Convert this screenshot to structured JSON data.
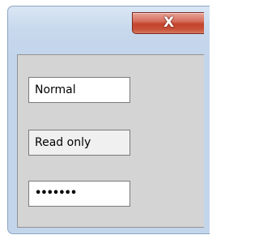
{
  "window": {
    "close_glyph": "X"
  },
  "fields": {
    "normal_value": "Normal",
    "readonly_value": "Read only",
    "password_value": "•••••••"
  },
  "colors": {
    "close_button": "#c4432c",
    "client_background": "#d4d4d4",
    "titlebar": "#c7d8ec"
  }
}
